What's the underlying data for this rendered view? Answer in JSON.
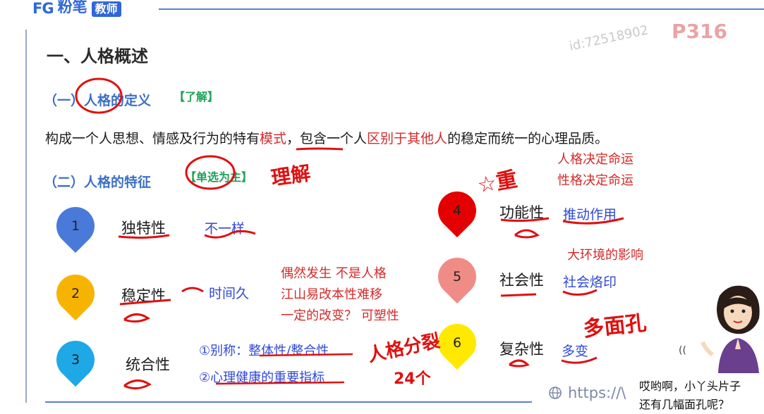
{
  "header": {
    "logo_mark": "FG",
    "brand": "粉笔",
    "tag": "教师",
    "page_code": "P316",
    "watermark": "id:72518902"
  },
  "title": "一、人格概述",
  "definition": {
    "heading": "（一）人格的定义",
    "tag": "【了解】",
    "text_parts": [
      "构成一个人思想、情感及行为的特有",
      "模式",
      "，包含一个人",
      "区别于其他人",
      "的",
      "稳定而统一",
      "的心理品质。"
    ]
  },
  "features": {
    "heading": "（二）人格的特征",
    "tag": "【单选为主】",
    "items": [
      {
        "num": "1",
        "name": "独特性",
        "note": "不一样",
        "color": "#4a7ad9"
      },
      {
        "num": "2",
        "name": "稳定性",
        "note": "时间久",
        "color": "#f6b400"
      },
      {
        "num": "3",
        "name": "统合性",
        "note": "",
        "color": "#1fa8e6"
      },
      {
        "num": "4",
        "name": "功能性",
        "note": "推动作用",
        "color": "#e40000"
      },
      {
        "num": "5",
        "name": "社会性",
        "note": "社会烙印",
        "color": "#ef8c86"
      },
      {
        "num": "6",
        "name": "复杂性",
        "note": "多变",
        "color": "#ffe900"
      }
    ],
    "integration_notes": [
      "①别称：整体性/整合性",
      "②心理健康的重要指标"
    ],
    "stability_notes": [
      "偶然发生 不是人格",
      "江山易改本性难移",
      "一定的改变？ 可塑性"
    ],
    "function_notes": [
      "人格决定命运",
      "性格决定命运"
    ],
    "social_note": "大环境的影响"
  },
  "handwriting": {
    "understand": "理解",
    "star": "☆重",
    "multi_face": "多面孔",
    "personality_split": "人格分裂",
    "count": "24个"
  },
  "footer": {
    "url": "https://\\",
    "bubble": [
      "哎哟啊，小丫头片子",
      "还有几幅面孔呢？"
    ]
  }
}
